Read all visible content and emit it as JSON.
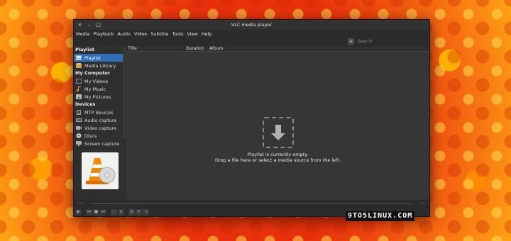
{
  "window": {
    "title": "VLC media player",
    "controls": {
      "close": "×",
      "minimize": "–",
      "maximize": "□"
    }
  },
  "menu": [
    "Media",
    "Playback",
    "Audio",
    "Video",
    "Subtitle",
    "Tools",
    "View",
    "Help"
  ],
  "search": {
    "placeholder": "Search"
  },
  "sidebar": {
    "groups": [
      {
        "label": "Playlist",
        "items": [
          {
            "label": "Playlist",
            "icon": "playlist-icon",
            "selected": true
          },
          {
            "label": "Media Library",
            "icon": "library-icon"
          }
        ]
      },
      {
        "label": "My Computer",
        "items": [
          {
            "label": "My Videos",
            "icon": "video-folder-icon"
          },
          {
            "label": "My Music",
            "icon": "music-icon"
          },
          {
            "label": "My Pictures",
            "icon": "picture-icon"
          }
        ]
      },
      {
        "label": "Devices",
        "items": [
          {
            "label": "MTP devices",
            "icon": "mtp-device-icon"
          },
          {
            "label": "Audio capture",
            "icon": "audio-capture-icon"
          },
          {
            "label": "Video capture",
            "icon": "video-capture-icon"
          },
          {
            "label": "Discs",
            "icon": "disc-icon"
          },
          {
            "label": "Screen capture",
            "icon": "screen-capture-icon"
          }
        ]
      }
    ]
  },
  "table": {
    "columns": [
      "Title",
      "Duration",
      "Album"
    ]
  },
  "empty": {
    "line1": "Playlist is currently empty.",
    "line2": "Drop a file here or select a media source from the left."
  },
  "seek": {
    "elapsed": "--:--",
    "total": "--:--"
  },
  "watermark": "9TO5LINUX.COM",
  "colors": {
    "selection": "#2f6fb8",
    "window": "#2b2b2b",
    "cone": "#f08a00"
  }
}
